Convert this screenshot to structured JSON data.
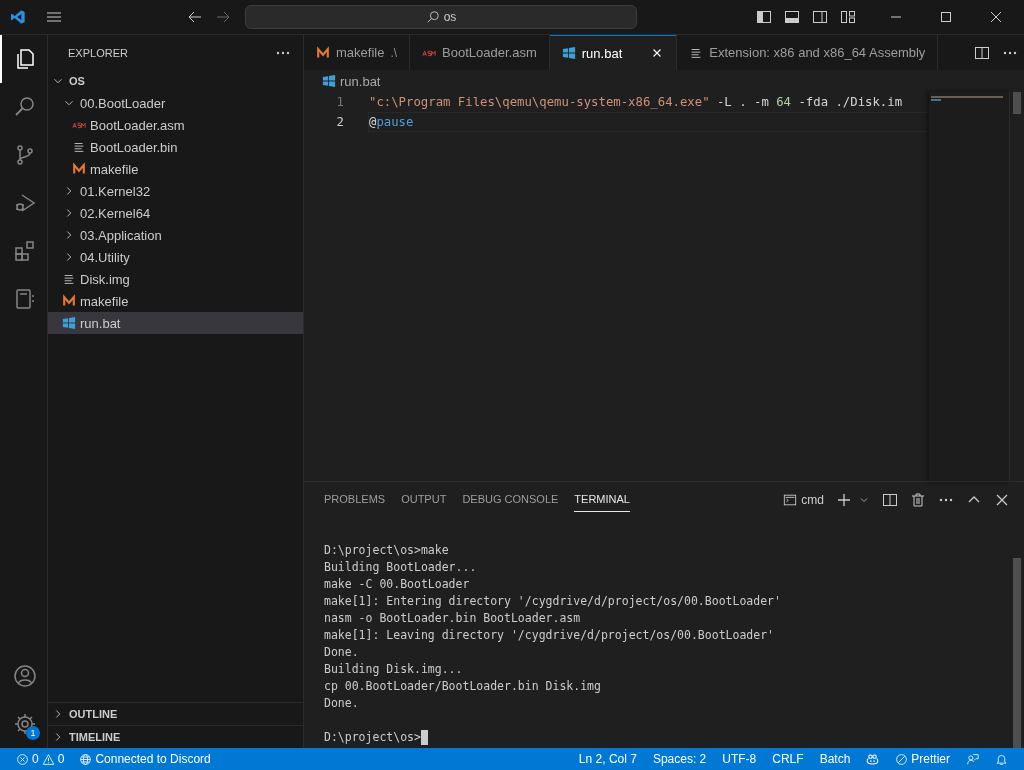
{
  "title_bar": {
    "search": "os"
  },
  "activity_bar": {
    "items": [
      {
        "kind": "explorer",
        "selected": true
      },
      {
        "kind": "search",
        "selected": false
      },
      {
        "kind": "source-control",
        "selected": false
      },
      {
        "kind": "run-debug",
        "selected": false
      },
      {
        "kind": "extensions",
        "selected": false
      },
      {
        "kind": "remote",
        "selected": false
      }
    ],
    "settings_badge": "1"
  },
  "sidebar": {
    "title": "EXPLORER",
    "root": {
      "label": "OS",
      "expanded": true
    },
    "tree": [
      {
        "label": "00.BootLoader",
        "kind": "folder",
        "expanded": true,
        "selected": false,
        "children": [
          {
            "label": "BootLoader.asm",
            "kind": "asm",
            "selected": false
          },
          {
            "label": "BootLoader.bin",
            "kind": "text",
            "selected": false
          },
          {
            "label": "makefile",
            "kind": "make",
            "selected": false
          }
        ]
      },
      {
        "label": "01.Kernel32",
        "kind": "folder",
        "expanded": false,
        "selected": false
      },
      {
        "label": "02.Kernel64",
        "kind": "folder",
        "expanded": false,
        "selected": false
      },
      {
        "label": "03.Application",
        "kind": "folder",
        "expanded": false,
        "selected": false
      },
      {
        "label": "04.Utility",
        "kind": "folder",
        "expanded": false,
        "selected": false
      },
      {
        "label": "Disk.img",
        "kind": "text",
        "selected": false
      },
      {
        "label": "makefile",
        "kind": "make",
        "selected": false
      },
      {
        "label": "run.bat",
        "kind": "bat",
        "selected": true
      }
    ],
    "sections": [
      {
        "label": "OUTLINE",
        "expanded": false
      },
      {
        "label": "TIMELINE",
        "expanded": false
      }
    ]
  },
  "tabs": [
    {
      "label": "makefile",
      "description": ".\\",
      "kind": "make",
      "selected": false
    },
    {
      "label": "BootLoader.asm",
      "kind": "asm",
      "selected": false
    },
    {
      "label": "run.bat",
      "kind": "bat",
      "selected": true
    },
    {
      "label": "Extension: x86 and x86_64 Assembly",
      "kind": "text",
      "selected": false
    }
  ],
  "breadcrumb": {
    "label": "run.bat",
    "kind": "bat"
  },
  "editor": {
    "lines": [
      {
        "number": "1",
        "current": false,
        "tokens": [
          {
            "kind": "string",
            "text": "\"c:\\Program Files\\qemu\\qemu-system-x86_64.exe\""
          },
          {
            "kind": "plain",
            "text": " -L . -m "
          },
          {
            "kind": "number",
            "text": "64"
          },
          {
            "kind": "plain",
            "text": " -fda ./Disk.im"
          }
        ]
      },
      {
        "number": "2",
        "current": true,
        "tokens": [
          {
            "kind": "plain",
            "text": "@"
          },
          {
            "kind": "keyword",
            "text": "pause"
          }
        ]
      }
    ]
  },
  "panel": {
    "tabs": [
      {
        "label": "PROBLEMS",
        "selected": false
      },
      {
        "label": "OUTPUT",
        "selected": false
      },
      {
        "label": "DEBUG CONSOLE",
        "selected": false
      },
      {
        "label": "TERMINAL",
        "selected": true
      }
    ],
    "shell": "cmd",
    "lines": [
      "D:\\project\\os>make",
      "Building BootLoader...",
      "make -C 00.BootLoader",
      "make[1]: Entering directory '/cygdrive/d/project/os/00.BootLoader'",
      "nasm -o BootLoader.bin BootLoader.asm",
      "make[1]: Leaving directory '/cygdrive/d/project/os/00.BootLoader'",
      "Done.",
      "Building Disk.img...",
      "cp 00.BootLoader/BootLoader.bin Disk.img",
      "Done."
    ],
    "prompt": "D:\\project\\os>"
  },
  "status_bar": {
    "errors": "0",
    "warnings": "0",
    "discord": "Connected to Discord",
    "items": [
      {
        "kind": "text",
        "text": "Ln 2, Col 7"
      },
      {
        "kind": "text",
        "text": "Spaces: 2"
      },
      {
        "kind": "text",
        "text": "UTF-8"
      },
      {
        "kind": "text",
        "text": "CRLF"
      },
      {
        "kind": "text",
        "text": "Batch"
      },
      {
        "kind": "copilot"
      },
      {
        "kind": "prettier",
        "text": "Prettier"
      },
      {
        "kind": "feedback"
      },
      {
        "kind": "bell"
      }
    ]
  }
}
